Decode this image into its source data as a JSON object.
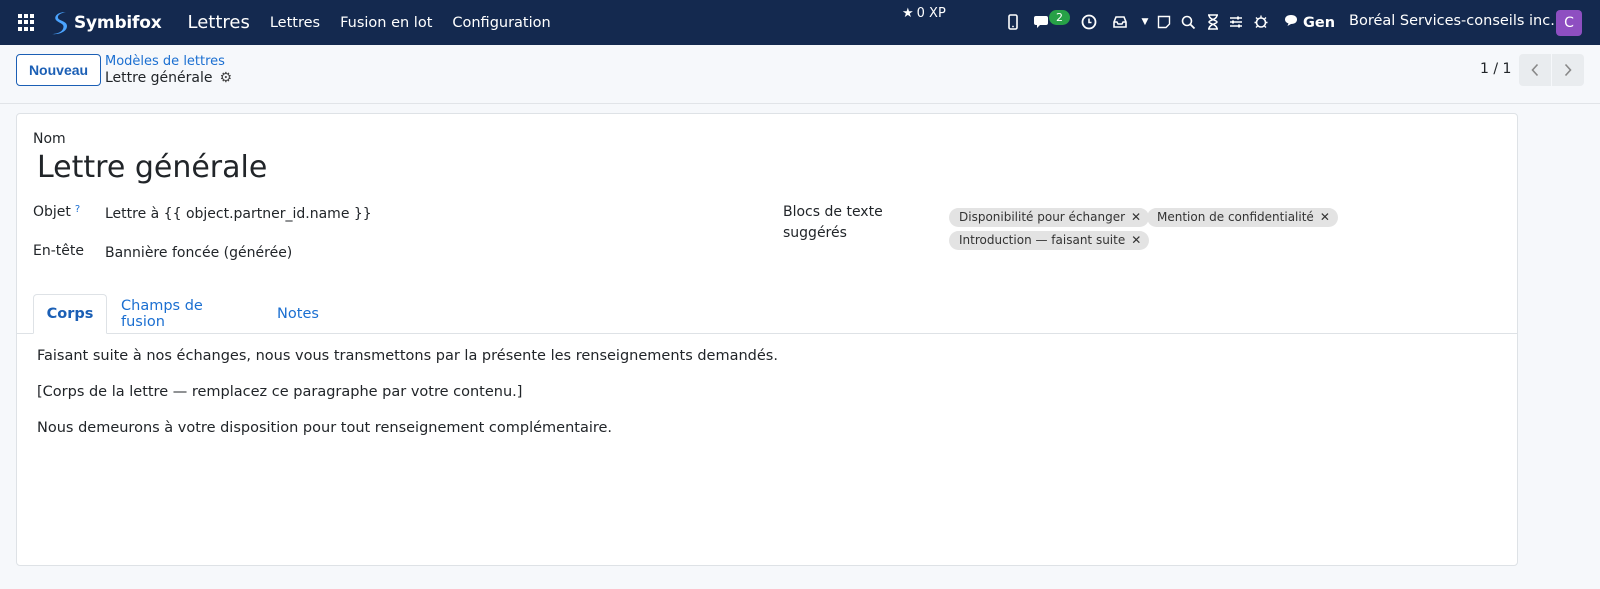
{
  "navbar": {
    "brand": "Symbifox",
    "app_title": "Lettres",
    "menu": [
      "Lettres",
      "Fusion en lot",
      "Configuration"
    ],
    "xp": "0 XP",
    "chat_badge": "2",
    "gen_label": "Gen",
    "company": "Boréal Services-conseils inc.",
    "avatar_letter": "C",
    "colors": {
      "bg": "#14294f",
      "avatar": "#8e4fc1",
      "badge": "#27a147"
    }
  },
  "control": {
    "new_label": "Nouveau",
    "breadcrumb_parent": "Modèles de lettres",
    "breadcrumb_current": "Lettre générale",
    "pager": "1 / 1"
  },
  "form": {
    "name_label": "Nom",
    "name_value": "Lettre générale",
    "subject_label": "Objet",
    "subject_help": "?",
    "subject_value": "Lettre à {{ object.partner_id.name }}",
    "header_label": "En-tête",
    "header_value": "Bannière foncée (générée)",
    "blocks_label_line1": "Blocs de texte",
    "blocks_label_line2": "suggérés",
    "tags": [
      "Disponibilité pour échanger",
      "Mention de confidentialité",
      "Introduction — faisant suite"
    ]
  },
  "tabs": [
    "Corps",
    "Champs de fusion",
    "Notes"
  ],
  "body": [
    "Faisant suite à nos échanges, nous vous transmettons par la présente les renseignements demandés.",
    "[Corps de la lettre — remplacez ce paragraphe par votre contenu.]",
    "Nous demeurons à votre disposition pour tout renseignement complémentaire."
  ]
}
